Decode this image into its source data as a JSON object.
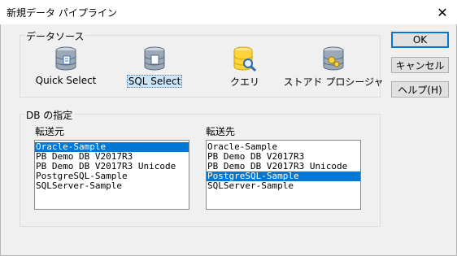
{
  "window": {
    "title": "新規データ パイプライン"
  },
  "datasource": {
    "group_label": "データソース",
    "items": [
      {
        "label": "Quick Select",
        "icon": "database-quick-select-icon",
        "selected": false
      },
      {
        "label": "SQL Select",
        "icon": "database-sql-select-icon",
        "selected": true
      },
      {
        "label": "クエリ",
        "icon": "query-magnifier-icon",
        "selected": false
      },
      {
        "label": "ストアド プロシージャ",
        "icon": "stored-procedure-icon",
        "selected": false
      }
    ]
  },
  "buttons": {
    "ok": "OK",
    "cancel": "キャンセル",
    "help": "ヘルプ(H)"
  },
  "db": {
    "group_label": "DB の指定",
    "source_label": "転送元",
    "dest_label": "転送先",
    "source_items": [
      "Oracle-Sample",
      "PB Demo DB V2017R3",
      "PB Demo DB V2017R3 Unicode",
      "PostgreSQL-Sample",
      "SQLServer-Sample"
    ],
    "source_selected": "Oracle-Sample",
    "dest_items": [
      "Oracle-Sample",
      "PB Demo DB V2017R3",
      "PB Demo DB V2017R3 Unicode",
      "PostgreSQL-Sample",
      "SQLServer-Sample"
    ],
    "dest_selected": "PostgreSQL-Sample"
  },
  "colors": {
    "selection": "#0078d7",
    "focus_border": "#0078d7",
    "selected_label_bg": "#cce4f7"
  }
}
